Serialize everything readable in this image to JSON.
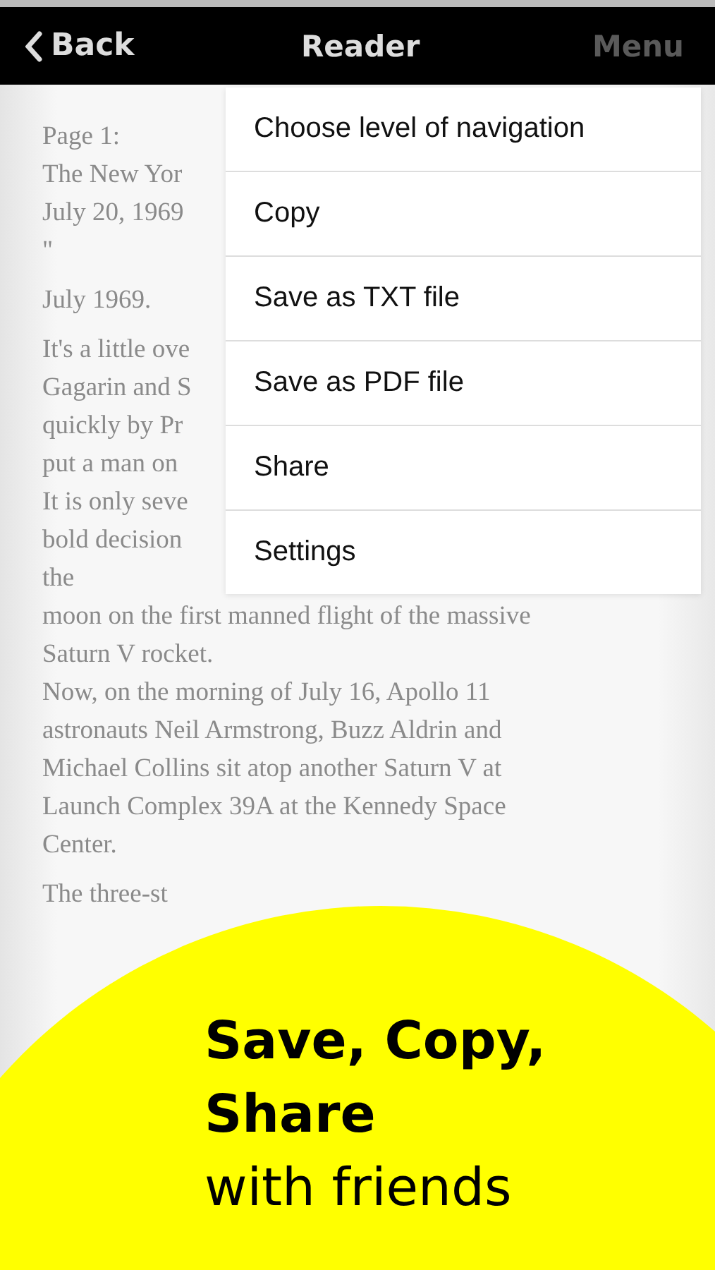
{
  "nav_bar": {
    "back": "Back",
    "title": "Reader",
    "menu": {
      "label": "Menu",
      "disabled": true
    }
  },
  "document": {
    "paragraphs": [
      {
        "lines": [
          "Page 1:",
          "The New Yor",
          "July 20, 1969",
          "\""
        ]
      },
      {
        "lines": [
          "July 1969."
        ]
      },
      {
        "lines": [
          "It's a little ove",
          "Gagarin and S",
          "quickly by Pr",
          "put a man on",
          "It is only seve",
          "bold decision",
          "the",
          "moon on the first manned flight of the massive",
          "Saturn V rocket.",
          "Now, on the morning of July 16, Apollo 11",
          "astronauts Neil Armstrong, Buzz Aldrin and",
          "Michael Collins sit atop another Saturn V at",
          "Launch Complex 39A at the Kennedy Space",
          "Center."
        ]
      },
      {
        "lines": [
          "The three-st"
        ]
      }
    ]
  },
  "menu": {
    "items": [
      "Choose level of navigation",
      "Copy",
      "Save as TXT file",
      "Save as PDF file",
      "Share",
      "Settings"
    ]
  },
  "promo": {
    "lines": [
      {
        "text": "Save, Copy,",
        "bold": true
      },
      {
        "text": "Share",
        "bold": true
      },
      {
        "text": "with friends",
        "bold": false
      }
    ]
  }
}
